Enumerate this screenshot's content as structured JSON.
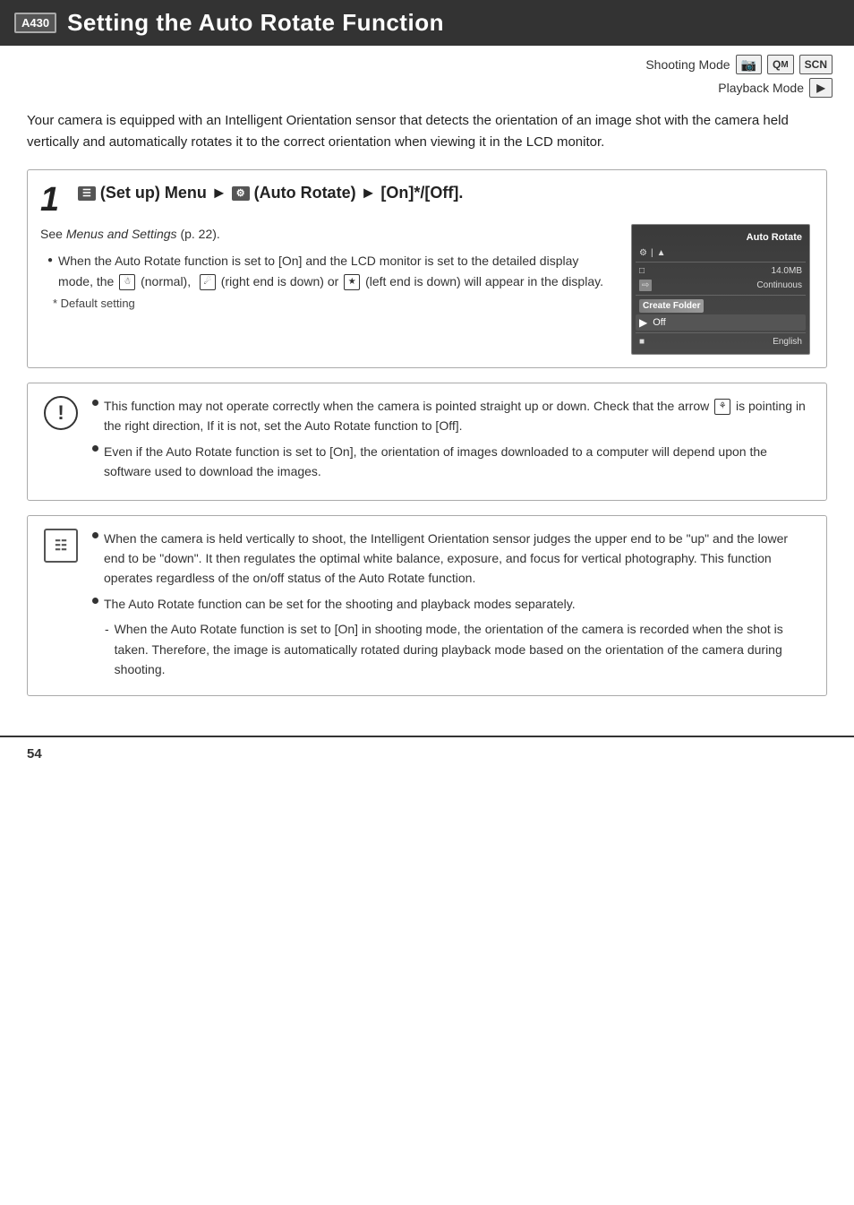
{
  "header": {
    "badge": "A430",
    "title": "Setting the Auto Rotate Function"
  },
  "modes": {
    "shooting_label": "Shooting Mode",
    "shooting_icons": [
      "🎥",
      "QM",
      "SCN"
    ],
    "playback_label": "Playback Mode",
    "playback_icon": "▶"
  },
  "intro": "Your camera is equipped with an Intelligent Orientation sensor that detects the orientation of an image shot with the camera held vertically and automatically rotates it to the correct orientation when viewing it in the LCD monitor.",
  "step1": {
    "number": "1",
    "title_parts": [
      "(Set up) Menu",
      "(Auto Rotate)",
      "[On]*/[Off]."
    ],
    "see_text": "See Menus and Settings (p. 22).",
    "bullets": [
      "When the Auto Rotate function is set to [On] and the LCD monitor is set to the detailed display mode, the  (normal),  (right end is down) or  (left end is down) will appear in the display."
    ],
    "default": "Default setting",
    "camera_screen": {
      "title": "Auto Rotate",
      "rows": [
        {
          "label": "14.0MB",
          "type": "info"
        },
        {
          "label": "Continuous",
          "type": "info"
        },
        {
          "label": "Create Folder",
          "type": "highlighted"
        },
        {
          "label": "Off",
          "type": "selected"
        },
        {
          "label": "English",
          "type": "info"
        }
      ]
    }
  },
  "warning_note": {
    "bullets": [
      "This function may not operate correctly when the camera is pointed straight up or down. Check that the arrow  is pointing in the right direction, If it is not, set the Auto Rotate function to [Off].",
      "Even if the Auto Rotate function is set to [On], the orientation of images downloaded to a computer will depend upon the software used to download the images."
    ]
  },
  "info_note": {
    "bullets": [
      "When the camera is held vertically to shoot, the Intelligent Orientation sensor judges the upper end to be \"up\" and the lower end to be \"down\". It then regulates the optimal white balance, exposure, and focus for vertical photography. This function operates regardless of the on/off status of the Auto Rotate function.",
      "The Auto Rotate function can be set for the shooting and playback modes separately."
    ],
    "sub_bullets": [
      "When the Auto Rotate function is set to [On] in shooting mode, the orientation of the camera is recorded when the shot is taken. Therefore, the image is automatically rotated during playback mode based on the orientation of the camera during shooting."
    ]
  },
  "page_number": "54"
}
